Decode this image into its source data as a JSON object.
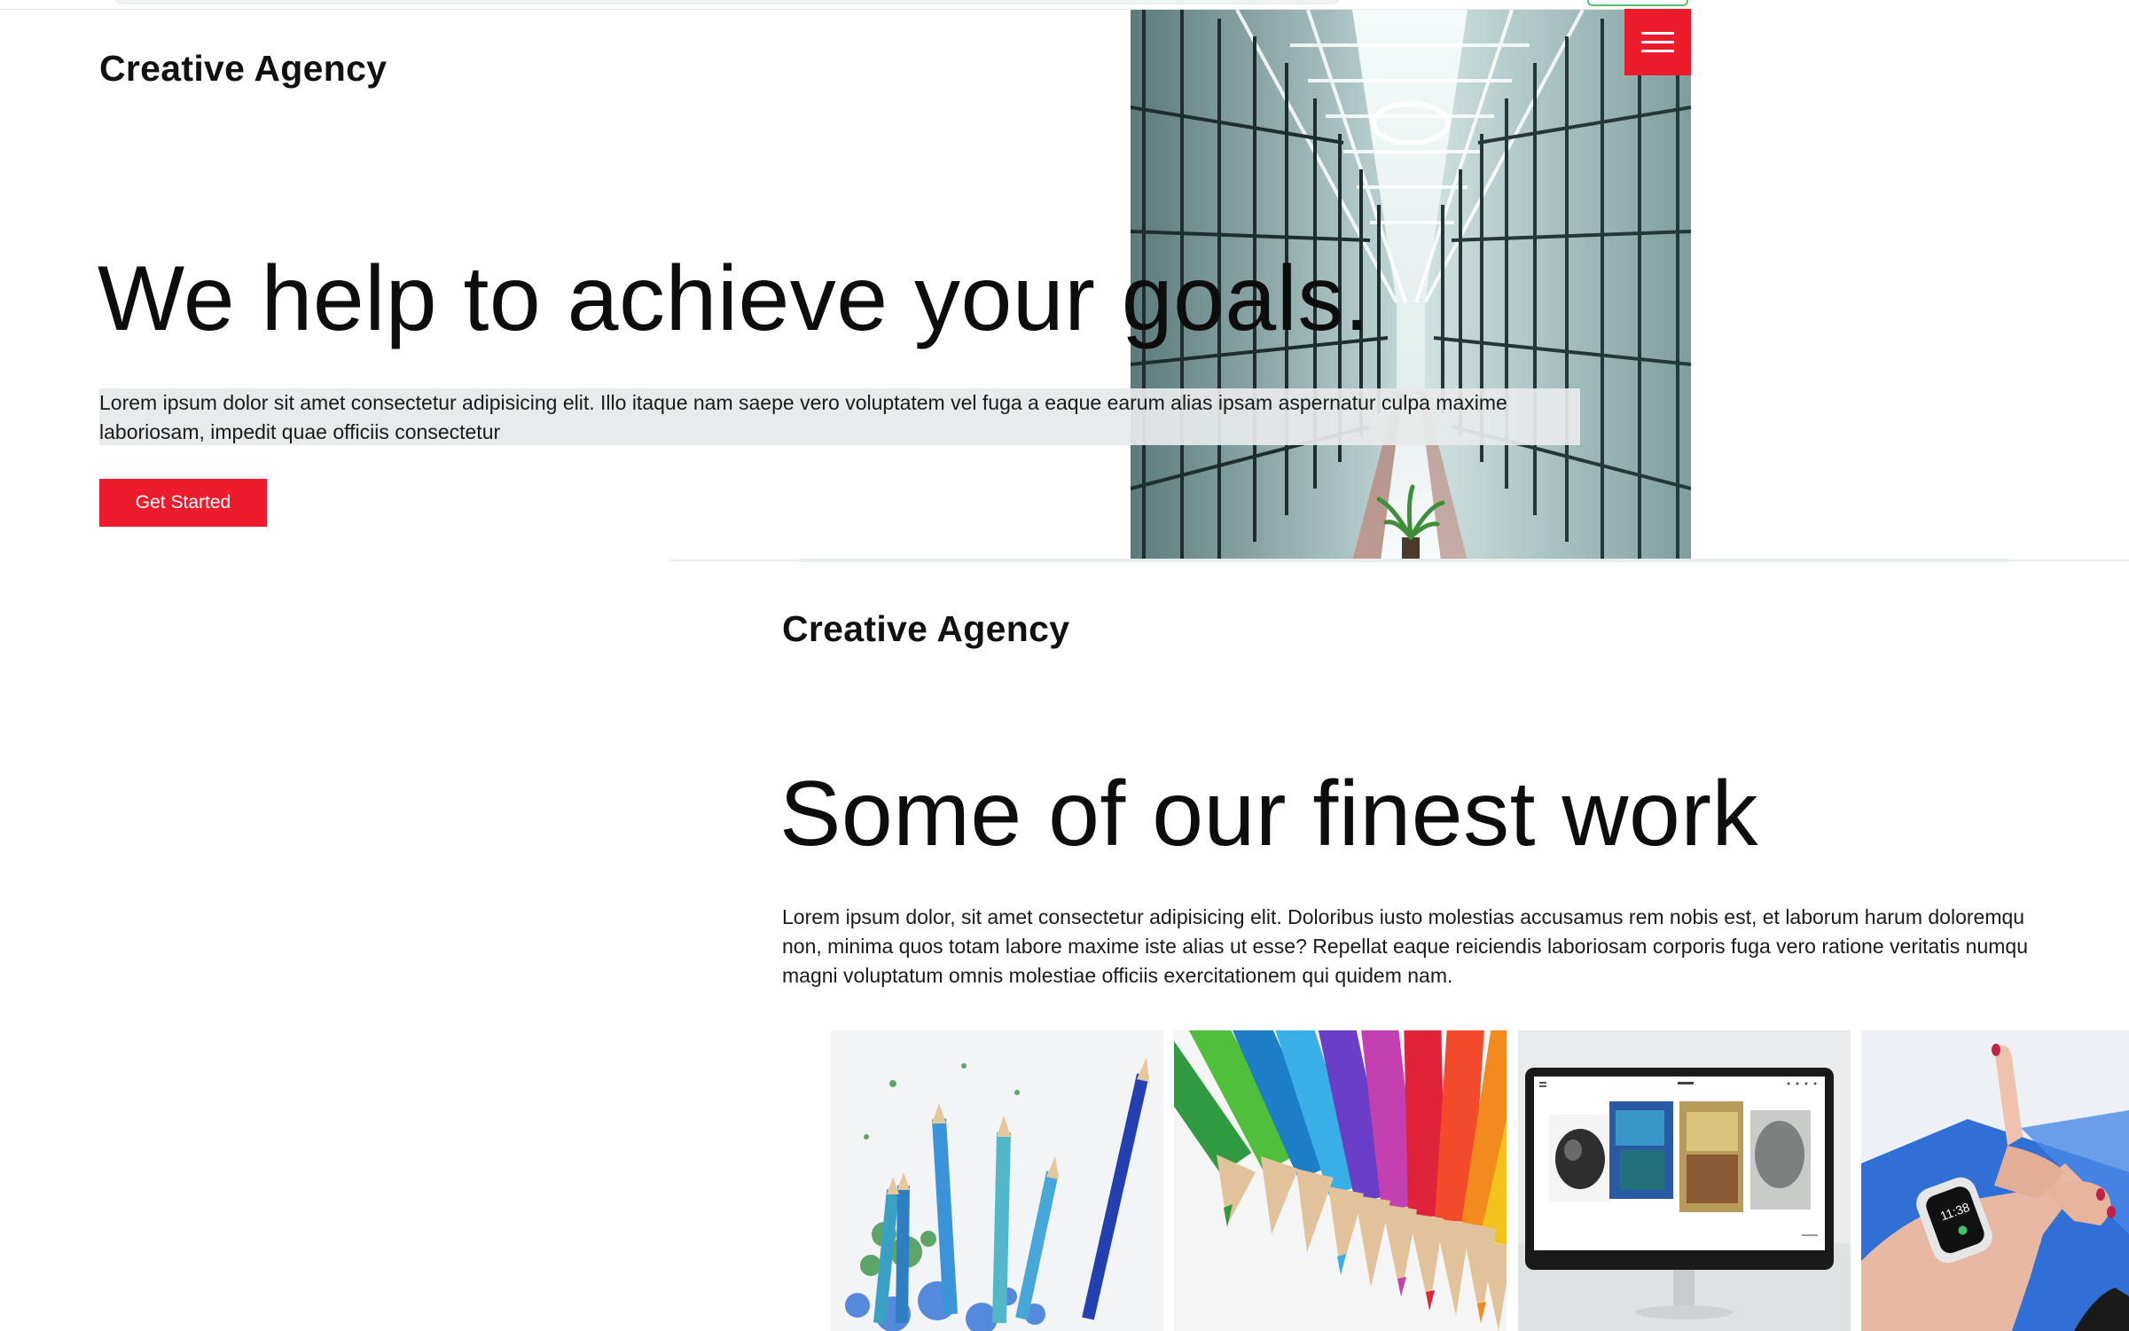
{
  "brand": {
    "name": "Creative Agency"
  },
  "hero": {
    "headline": "We help to achieve your goals.",
    "lead": "Lorem ipsum dolor sit amet consectetur adipisicing elit. Illo itaque nam saepe vero voluptatem vel fuga a eaque earum alias ipsam aspernatur culpa maxime laboriosam, impedit quae officiis consectetur",
    "cta_label": "Get Started",
    "image": "glass-atrium-building-image"
  },
  "menu": {
    "icon": "hamburger-menu-icon"
  },
  "work": {
    "headline": "Some of our finest work",
    "lead_lines": [
      "Lorem ipsum dolor, sit amet consectetur adipisicing elit. Doloribus iusto molestias accusamus rem nobis est, et laborum harum doloremqu",
      "non, minima quos totam labore maxime iste alias ut esse? Repellat eaque reiciendis laboriosam corporis fuga vero ratione veritatis numqu",
      "magni voluptatum omnis molestiae officiis exercitationem qui quidem nam."
    ],
    "gallery": [
      {
        "subject": "blue-pencils-shavings-image"
      },
      {
        "subject": "colored-pencils-image"
      },
      {
        "subject": "desktop-monitor-gallery-image"
      },
      {
        "subject": "smartwatch-wrist-image"
      }
    ]
  },
  "colors": {
    "accent": "#ec1c2d",
    "text": "#111111",
    "lead_highlight": "#e6eae9",
    "background": "#ffffff"
  }
}
